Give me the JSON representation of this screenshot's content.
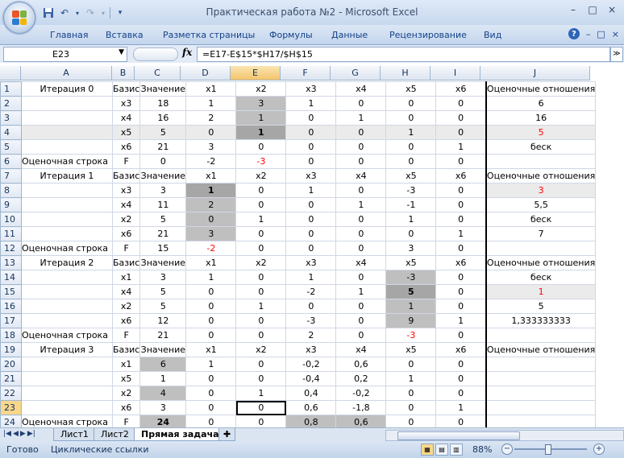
{
  "window": {
    "title": "Практическая работа №2 - Microsoft Excel",
    "controls": [
      "–",
      "□",
      "×"
    ]
  },
  "qat": {
    "save_icon": "save-icon",
    "undo_icon": "undo-icon",
    "redo_icon": "redo-icon"
  },
  "ribbon": {
    "tabs": [
      "Главная",
      "Вставка",
      "Разметка страницы",
      "Формулы",
      "Данные",
      "Рецензирование",
      "Вид"
    ],
    "help": "?",
    "win_controls": [
      "–",
      "□",
      "×"
    ]
  },
  "formula_bar": {
    "name_box": "E23",
    "fx": "fx",
    "formula": "=E17-E$15*$H17/$H$15"
  },
  "columns": [
    "A",
    "B",
    "C",
    "D",
    "E",
    "F",
    "G",
    "H",
    "I",
    "J"
  ],
  "selected_column": "E",
  "selected_row": 23,
  "rows": [
    {
      "n": 1,
      "cells": [
        "Итерация 0",
        "Базис",
        "Значение",
        "x1",
        "x2",
        "x3",
        "x4",
        "x5",
        "x6",
        "Оценочные отношения"
      ]
    },
    {
      "n": 2,
      "cells": [
        "",
        "x3",
        "18",
        "1",
        "3",
        "1",
        "0",
        "0",
        "0",
        "6"
      ]
    },
    {
      "n": 3,
      "cells": [
        "",
        "x4",
        "16",
        "2",
        "1",
        "0",
        "1",
        "0",
        "0",
        "16"
      ]
    },
    {
      "n": 4,
      "cells": [
        "",
        "x5",
        "5",
        "0",
        "1",
        "0",
        "0",
        "1",
        "0",
        "5"
      ]
    },
    {
      "n": 5,
      "cells": [
        "",
        "x6",
        "21",
        "3",
        "0",
        "0",
        "0",
        "0",
        "1",
        "беск"
      ]
    },
    {
      "n": 6,
      "cells": [
        "Оценочная строка",
        "F",
        "0",
        "-2",
        "-3",
        "0",
        "0",
        "0",
        "0",
        ""
      ]
    },
    {
      "n": 7,
      "cells": [
        "Итерация 1",
        "Базис",
        "Значение",
        "x1",
        "x2",
        "x3",
        "x4",
        "x5",
        "x6",
        "Оценочные отношения"
      ]
    },
    {
      "n": 8,
      "cells": [
        "",
        "x3",
        "3",
        "1",
        "0",
        "1",
        "0",
        "-3",
        "0",
        "3"
      ]
    },
    {
      "n": 9,
      "cells": [
        "",
        "x4",
        "11",
        "2",
        "0",
        "0",
        "1",
        "-1",
        "0",
        "5,5"
      ]
    },
    {
      "n": 10,
      "cells": [
        "",
        "x2",
        "5",
        "0",
        "1",
        "0",
        "0",
        "1",
        "0",
        "беск"
      ]
    },
    {
      "n": 11,
      "cells": [
        "",
        "x6",
        "21",
        "3",
        "0",
        "0",
        "0",
        "0",
        "1",
        "7"
      ]
    },
    {
      "n": 12,
      "cells": [
        "Оценочная строка",
        "F",
        "15",
        "-2",
        "0",
        "0",
        "0",
        "3",
        "0",
        ""
      ]
    },
    {
      "n": 13,
      "cells": [
        "Итерация 2",
        "Базис",
        "Значение",
        "x1",
        "x2",
        "x3",
        "x4",
        "x5",
        "x6",
        "Оценочные отношения"
      ]
    },
    {
      "n": 14,
      "cells": [
        "",
        "x1",
        "3",
        "1",
        "0",
        "1",
        "0",
        "-3",
        "0",
        "беск"
      ]
    },
    {
      "n": 15,
      "cells": [
        "",
        "x4",
        "5",
        "0",
        "0",
        "-2",
        "1",
        "5",
        "0",
        "1"
      ]
    },
    {
      "n": 16,
      "cells": [
        "",
        "x2",
        "5",
        "0",
        "1",
        "0",
        "0",
        "1",
        "0",
        "5"
      ]
    },
    {
      "n": 17,
      "cells": [
        "",
        "x6",
        "12",
        "0",
        "0",
        "-3",
        "0",
        "9",
        "1",
        "1,333333333"
      ]
    },
    {
      "n": 18,
      "cells": [
        "Оценочная строка",
        "F",
        "21",
        "0",
        "0",
        "2",
        "0",
        "-3",
        "0",
        ""
      ]
    },
    {
      "n": 19,
      "cells": [
        "Итерация 3",
        "Базис",
        "Значение",
        "x1",
        "x2",
        "x3",
        "x4",
        "x5",
        "x6",
        "Оценочные отношения"
      ]
    },
    {
      "n": 20,
      "cells": [
        "",
        "x1",
        "6",
        "1",
        "0",
        "-0,2",
        "0,6",
        "0",
        "0",
        ""
      ]
    },
    {
      "n": 21,
      "cells": [
        "",
        "x5",
        "1",
        "0",
        "0",
        "-0,4",
        "0,2",
        "1",
        "0",
        ""
      ]
    },
    {
      "n": 22,
      "cells": [
        "",
        "x2",
        "4",
        "0",
        "1",
        "0,4",
        "-0,2",
        "0",
        "0",
        ""
      ]
    },
    {
      "n": 23,
      "cells": [
        "",
        "x6",
        "3",
        "0",
        "0",
        "0,6",
        "-1,8",
        "0",
        "1",
        ""
      ]
    },
    {
      "n": 24,
      "cells": [
        "Оценочная строка",
        "F",
        "24",
        "0",
        "0",
        "0,8",
        "0,6",
        "0",
        "0",
        ""
      ]
    }
  ],
  "sheet_tabs": [
    "Лист1",
    "Лист2",
    "Прямая задача"
  ],
  "active_sheet": "Прямая задача",
  "status": {
    "ready": "Готово",
    "circular": "Циклические ссылки",
    "zoom": "88%"
  }
}
